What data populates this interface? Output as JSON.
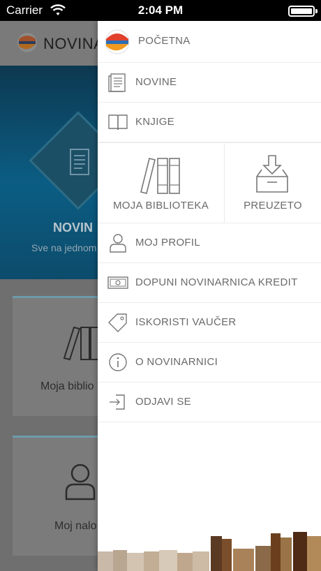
{
  "status_bar": {
    "carrier": "Carrier",
    "time": "2:04 PM",
    "icons": [
      "wifi-icon",
      "battery-icon"
    ]
  },
  "background_screen": {
    "brand": "NOVINA",
    "hero_title": "NOVIN",
    "hero_subtitle": "Sve na jednom",
    "cards": [
      {
        "label": "Moja biblio",
        "icon": "library-icon"
      },
      {
        "label": "Moj nalo",
        "icon": "user-icon"
      }
    ]
  },
  "drawer": {
    "home": {
      "label": "POČETNA",
      "icon": "app-logo-icon"
    },
    "items": [
      {
        "label": "NOVINE",
        "icon": "newspaper-icon"
      },
      {
        "label": "KNJIGE",
        "icon": "book-icon"
      }
    ],
    "tiles": [
      {
        "label": "MOJA BIBLIOTEKA",
        "icon": "library-icon"
      },
      {
        "label": "PREUZETO",
        "icon": "download-box-icon"
      }
    ],
    "items2": [
      {
        "label": "MOJ PROFIL",
        "icon": "user-icon"
      },
      {
        "label": "DOPUNI NOVINARNICA KREDIT",
        "icon": "banknote-icon"
      },
      {
        "label": "ISKORISTI VAUČER",
        "icon": "tag-icon"
      },
      {
        "label": "O NOVINARNICI",
        "icon": "info-icon"
      },
      {
        "label": "ODJAVI SE",
        "icon": "logout-icon"
      }
    ]
  },
  "colors": {
    "menu_text": "#6a6a6a",
    "logo_red": "#e0402c",
    "logo_blue": "#2a6fb8",
    "logo_orange": "#f29a1f",
    "hero_blue": "#0b5d84"
  }
}
